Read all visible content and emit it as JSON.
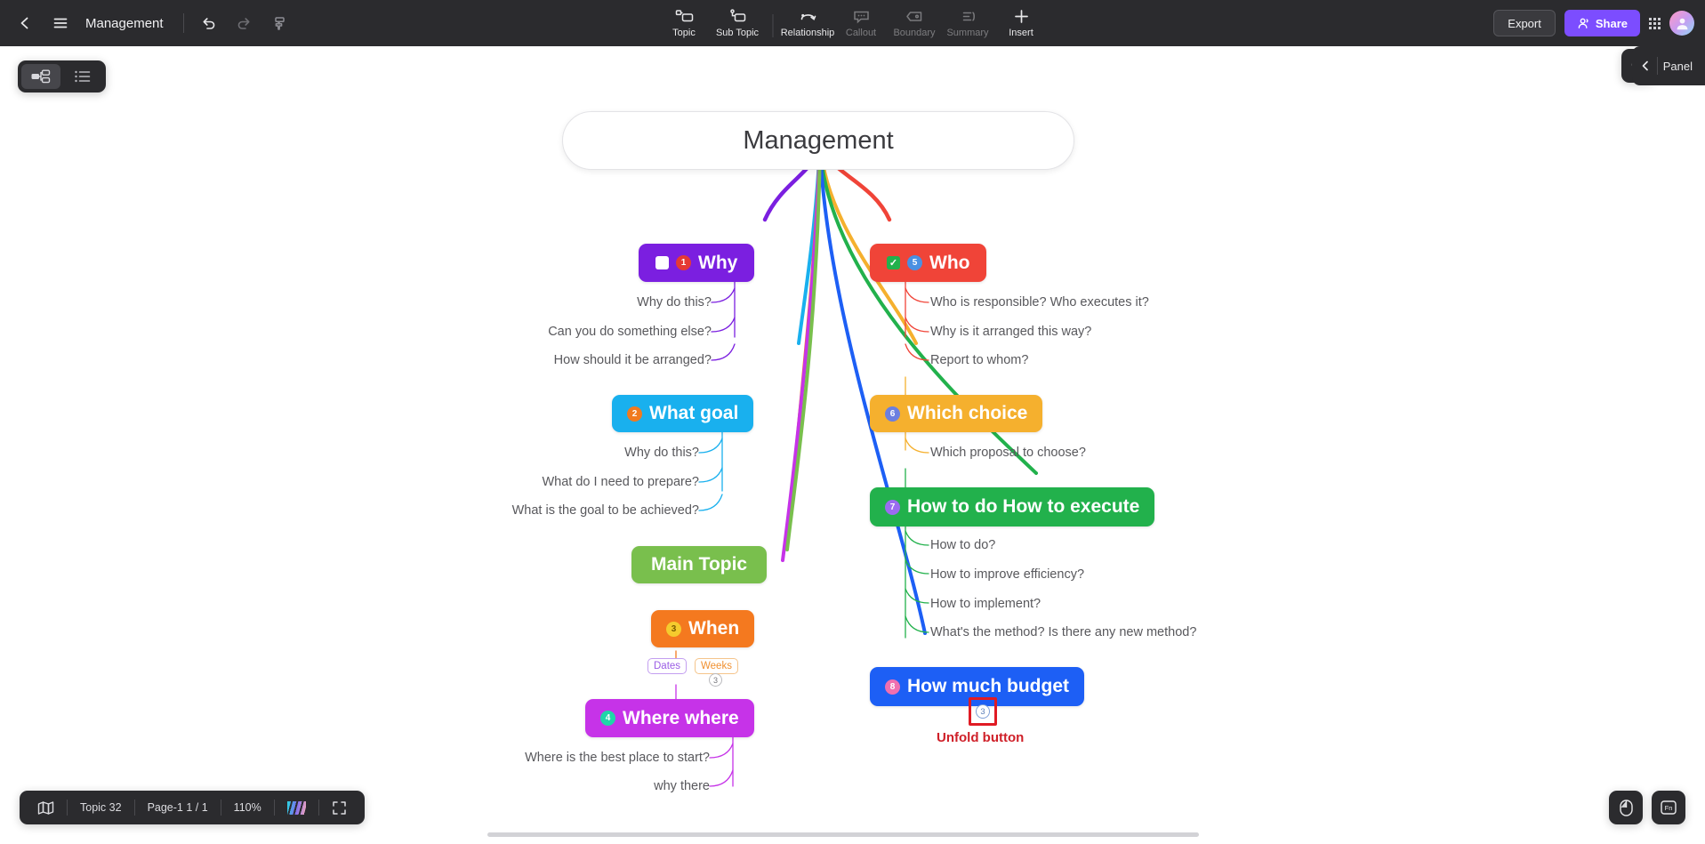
{
  "topbar": {
    "back_icon": "chevron-left-icon",
    "menu_icon": "hamburger-menu-icon",
    "doc_title": "Management",
    "undo_icon": "undo-icon",
    "redo_icon": "redo-icon",
    "format_painter_icon": "format-painter-icon",
    "tools": [
      {
        "label": "Topic",
        "icon": "topic-icon",
        "state": "enabled"
      },
      {
        "label": "Sub Topic",
        "icon": "sub-topic-icon",
        "state": "enabled"
      },
      {
        "label": "Relationship",
        "icon": "relationship-icon",
        "state": "enabled"
      },
      {
        "label": "Callout",
        "icon": "callout-icon",
        "state": "disabled"
      },
      {
        "label": "Boundary",
        "icon": "boundary-icon",
        "state": "disabled"
      },
      {
        "label": "Summary",
        "icon": "summary-icon",
        "state": "disabled"
      },
      {
        "label": "Insert",
        "icon": "plus-icon",
        "state": "enabled"
      }
    ],
    "export_label": "Export",
    "share_label": "Share",
    "apps_icon": "grid-apps-icon",
    "avatar_icon": "user-avatar"
  },
  "view_toggle": {
    "mindmap_icon": "mindmap-view-icon",
    "outline_icon": "outline-view-icon",
    "selected": "mindmap"
  },
  "right_rail": {
    "search_icon": "search-icon",
    "panel_label": "Panel",
    "collapse_icon": "chevron-left-icon"
  },
  "mindmap": {
    "root": {
      "label": "Management"
    },
    "nodes": [
      {
        "id": "why",
        "label": "Why",
        "badge": "1",
        "badge_color": "#e53935",
        "bg": "#7b1fe0",
        "checkbox": "unchecked"
      },
      {
        "id": "who",
        "label": "Who",
        "badge": "5",
        "badge_color": "#4a90e2",
        "bg": "#f04438",
        "checkbox": "checked"
      },
      {
        "id": "goal",
        "label": "What goal",
        "badge": "2",
        "badge_color": "#f07a20",
        "bg": "#19b0ee",
        "checkbox": "none"
      },
      {
        "id": "which",
        "label": "Which choice",
        "badge": "6",
        "badge_color": "#6b7fe0",
        "bg": "#f5b02e",
        "checkbox": "none"
      },
      {
        "id": "how",
        "label": "How to do How to execute",
        "badge": "7",
        "badge_color": "#9b6bf0",
        "bg": "#22b14c",
        "checkbox": "none"
      },
      {
        "id": "main",
        "label": "Main Topic",
        "badge": "",
        "badge_color": "",
        "bg": "#79bf4d",
        "checkbox": "none"
      },
      {
        "id": "when",
        "label": "When",
        "badge": "3",
        "badge_color": "#f5cb2e",
        "bg": "#f4791f",
        "checkbox": "none"
      },
      {
        "id": "where",
        "label": "Where where",
        "badge": "4",
        "badge_color": "#1fd6a8",
        "bg": "#c633e8",
        "checkbox": "none"
      },
      {
        "id": "budget",
        "label": "How much budget",
        "badge": "8",
        "badge_color": "#f06fb0",
        "bg": "#1d5ff5",
        "checkbox": "none"
      }
    ],
    "leaves": {
      "why": [
        "Why do this?",
        "Can you do something else?",
        "How should it be arranged?"
      ],
      "who": [
        "Who is responsible? Who executes it?",
        "Why is it arranged this way?",
        "Report to whom?"
      ],
      "goal": [
        "Why do this?",
        "What do I need to prepare?",
        "What is the goal to be achieved?"
      ],
      "which": [
        "Which proposal to choose?"
      ],
      "how": [
        "How to do?",
        "How to improve efficiency?",
        "How to implement?",
        "What's the method? Is there any new method?"
      ],
      "where": [
        "Where is the best place to start?",
        "why there"
      ]
    },
    "tags": [
      {
        "label": "Dates",
        "color": "#9b5de5"
      },
      {
        "label": "Weeks",
        "color": "#f09030"
      }
    ],
    "weeks_count": "3",
    "unfold_count": "3"
  },
  "annotation": {
    "label": "Unfold button",
    "color": "#cf2029"
  },
  "statusbar": {
    "map_icon": "map-overview-icon",
    "topic_count": "Topic 32",
    "page": "Page-1  1 / 1",
    "zoom": "110%",
    "theme_icon": "theme-gradient-icon",
    "fullscreen_icon": "fullscreen-icon"
  },
  "fabs": [
    {
      "icon": "mouse-icon"
    },
    {
      "icon": "fn-key-icon"
    }
  ]
}
